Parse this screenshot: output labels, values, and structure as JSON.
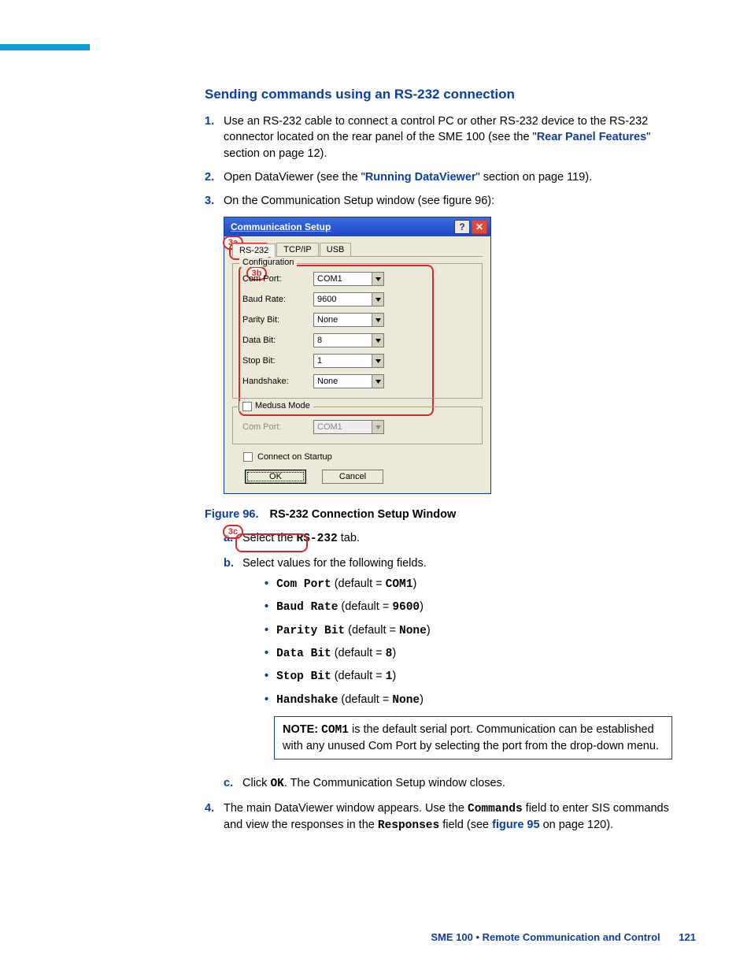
{
  "heading": "Sending commands using an RS-232 connection",
  "steps": {
    "s1": {
      "num": "1.",
      "pre": "Use an RS-232 cable to connect a control PC or other RS-232 device to the RS-232 connector located on the rear panel of the SME 100 (see the \"",
      "link": "Rear Panel Features",
      "post": "\" section on page 12)."
    },
    "s2": {
      "num": "2.",
      "pre": "Open DataViewer (see the \"",
      "link": "Running DataViewer",
      "post": "\" section on page 119)."
    },
    "s3": {
      "num": "3.",
      "text": "On the Communication Setup window (see figure 96):"
    },
    "s4": {
      "num": "4.",
      "pre": "The main DataViewer window appears. Use the ",
      "mono1": "Commands",
      "mid": " field to enter SIS commands and view the responses in the ",
      "mono2": "Responses",
      "post1": " field (see ",
      "link": "figure 95",
      "post2": " on page 120)."
    }
  },
  "dialog": {
    "title": "Communication Setup",
    "tabs": {
      "t1": "RS-232",
      "t2": "TCP/IP",
      "t3": "USB"
    },
    "cfgLegend": "Configuration",
    "fields": {
      "comport": {
        "label": "Com Port:",
        "value": "COM1"
      },
      "baudrate": {
        "label": "Baud Rate:",
        "value": "9600"
      },
      "parity": {
        "label": "Parity Bit:",
        "value": "None"
      },
      "databit": {
        "label": "Data Bit:",
        "value": "8"
      },
      "stopbit": {
        "label": "Stop Bit:",
        "value": "1"
      },
      "handshake": {
        "label": "Handshake:",
        "value": "None"
      }
    },
    "medusaLegend": "Medusa Mode",
    "medusa": {
      "label": "Com Port:",
      "value": "COM1"
    },
    "connectStartup": "Connect on Startup",
    "okLabel": "OK",
    "cancelLabel": "Cancel",
    "callouts": {
      "a": "3a",
      "b": "3b",
      "c": "3c"
    }
  },
  "figure": {
    "num": "Figure 96.",
    "title": "RS-232 Connection Setup Window"
  },
  "subs": {
    "a": {
      "num": "a.",
      "pre": "Select the ",
      "mono": "RS-232",
      "post": " tab."
    },
    "b": {
      "num": "b.",
      "text": "Select values for the following fields."
    },
    "c": {
      "num": "c.",
      "pre": "Click ",
      "mono": "OK",
      "post": ". The Communication Setup window closes."
    }
  },
  "bullets": {
    "b1": {
      "m1": "Com Port",
      "mid": " (default = ",
      "m2": "COM1",
      "post": ")"
    },
    "b2": {
      "m1": "Baud Rate",
      "mid": " (default = ",
      "m2": "9600",
      "post": ")"
    },
    "b3": {
      "m1": "Parity Bit",
      "mid": " (default = ",
      "m2": "None",
      "post": ")"
    },
    "b4": {
      "m1": "Data Bit",
      "mid": " (default = ",
      "m2": "8",
      "post": ")"
    },
    "b5": {
      "m1": "Stop Bit",
      "mid": " (default = ",
      "m2": "1",
      "post": ")"
    },
    "b6": {
      "m1": "Handshake",
      "mid": " (default = ",
      "m2": "None",
      "post": ")"
    }
  },
  "note": {
    "label": "NOTE:",
    "mono": "COM1",
    "text": " is the default serial port. Communication can be established with any unused Com Port by selecting the port from the drop-down menu."
  },
  "footer": {
    "text": "SME 100 • Remote Communication and Control",
    "page": "121"
  }
}
